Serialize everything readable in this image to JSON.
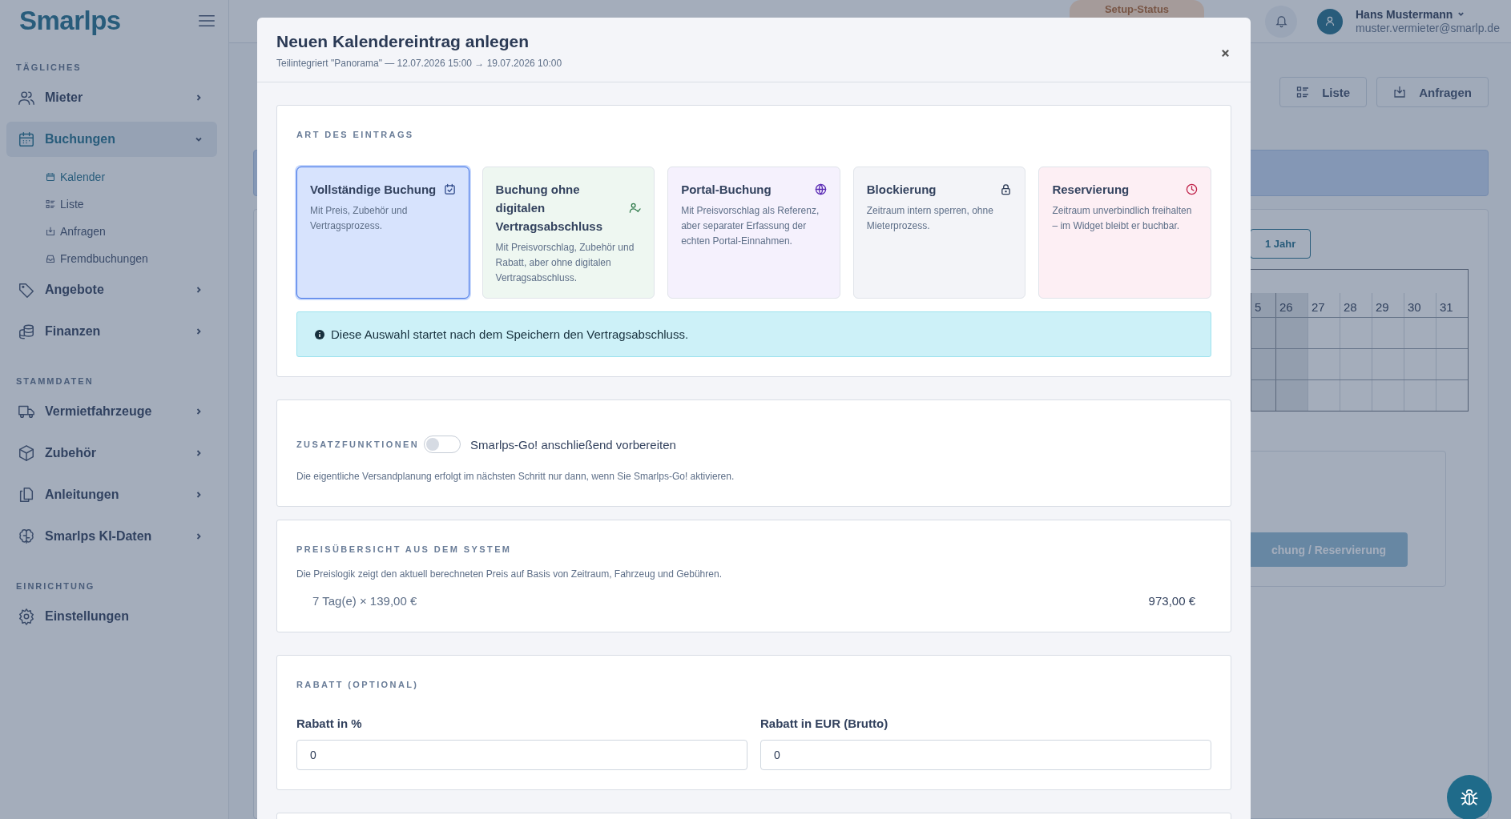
{
  "sidebar": {
    "logo": "Smarlps",
    "sections": [
      {
        "heading": "TÄGLICHES",
        "items": [
          {
            "label": "Mieter",
            "selected": false,
            "expanded": false
          },
          {
            "label": "Buchungen",
            "selected": true,
            "expanded": true,
            "children": [
              {
                "label": "Kalender",
                "selected": true
              },
              {
                "label": "Liste",
                "selected": false
              },
              {
                "label": "Anfragen",
                "selected": false
              },
              {
                "label": "Fremdbuchungen",
                "selected": false
              }
            ]
          },
          {
            "label": "Angebote",
            "selected": false,
            "expanded": false
          },
          {
            "label": "Finanzen",
            "selected": false,
            "expanded": false
          }
        ]
      },
      {
        "heading": "STAMMDATEN",
        "items": [
          {
            "label": "Vermietfahrzeuge",
            "selected": false,
            "expanded": false
          },
          {
            "label": "Zubehör",
            "selected": false,
            "expanded": false
          },
          {
            "label": "Anleitungen",
            "selected": false,
            "expanded": false
          },
          {
            "label": "Smarlps KI-Daten",
            "selected": false,
            "expanded": false
          }
        ]
      },
      {
        "heading": "EINRICHTUNG",
        "items": [
          {
            "label": "Einstellungen",
            "selected": false
          }
        ]
      }
    ]
  },
  "header": {
    "setup_status": "Setup-Status",
    "user": {
      "name": "Hans Mustermann",
      "email": "muster.vermieter@smarlp.de"
    }
  },
  "background": {
    "view_buttons": [
      {
        "label": "Liste"
      },
      {
        "label": "Anfragen"
      }
    ],
    "range_button": "1 Jahr",
    "calendar_days": [
      {
        "label": "5",
        "shaded": true
      },
      {
        "label": "26",
        "shaded": true
      },
      {
        "label": "27",
        "shaded": false
      },
      {
        "label": "28",
        "shaded": false
      },
      {
        "label": "29",
        "shaded": false
      },
      {
        "label": "30",
        "shaded": false
      },
      {
        "label": "31",
        "shaded": false
      }
    ],
    "action_button": "chung / Reservierung"
  },
  "dialog": {
    "title": "Neuen Kalendereintrag anlegen",
    "subtitle": "Teilintegriert \"Panorama\" — 12.07.2026 15:00 → 19.07.2026 10:00",
    "entry_type": {
      "heading": "ART DES EINTRAGS",
      "options": [
        {
          "kind": "full",
          "title": "Vollständige Buchung",
          "description": "Mit Preis, Zubehör und Vertragsprozess.",
          "color": "#d7e3fd",
          "selected": true
        },
        {
          "kind": "offline",
          "title": "Buchung ohne digitalen Vertragsabschluss",
          "description": "Mit Preisvorschlag, Zubehör und Rabatt, aber ohne digitalen Vertragsabschluss.",
          "color": "#eef7f1",
          "selected": false
        },
        {
          "kind": "portal",
          "title": "Portal-Buchung",
          "description": "Mit Preisvorschlag als Referenz, aber separater Erfassung der echten Portal-Einnahmen.",
          "color": "#f5f1fd",
          "selected": false
        },
        {
          "kind": "block",
          "title": "Blockierung",
          "description": "Zeitraum intern sperren, ohne Mieterprozess.",
          "color": "#f3f4f8",
          "selected": false
        },
        {
          "kind": "reserve",
          "title": "Reservierung",
          "description": "Zeitraum unverbindlich freihalten – im Widget bleibt er buchbar.",
          "color": "#fdeff4",
          "selected": false
        }
      ],
      "info": "Diese Auswahl startet nach dem Speichern den Vertragsabschluss."
    },
    "extras": {
      "heading": "ZUSATZFUNKTIONEN",
      "toggle": {
        "label": "Smarlps-Go! anschließend vorbereiten",
        "on": false
      },
      "note": "Die eigentliche Versandplanung erfolgt im nächsten Schritt nur dann, wenn Sie Smarlps-Go! aktivieren."
    },
    "price_overview": {
      "heading": "PREISÜBERSICHT AUS DEM SYSTEM",
      "note": "Die Preislogik zeigt den aktuell berechneten Preis auf Basis von Zeitraum, Fahrzeug und Gebühren.",
      "lines": [
        {
          "label": "7 Tag(e) × 139,00 €",
          "amount": "973,00 €"
        }
      ]
    },
    "discount": {
      "heading": "RABATT (OPTIONAL)",
      "fields": [
        {
          "label": "Rabatt in %",
          "value": "0"
        },
        {
          "label": "Rabatt in EUR (Brutto)",
          "value": "0"
        }
      ]
    }
  }
}
